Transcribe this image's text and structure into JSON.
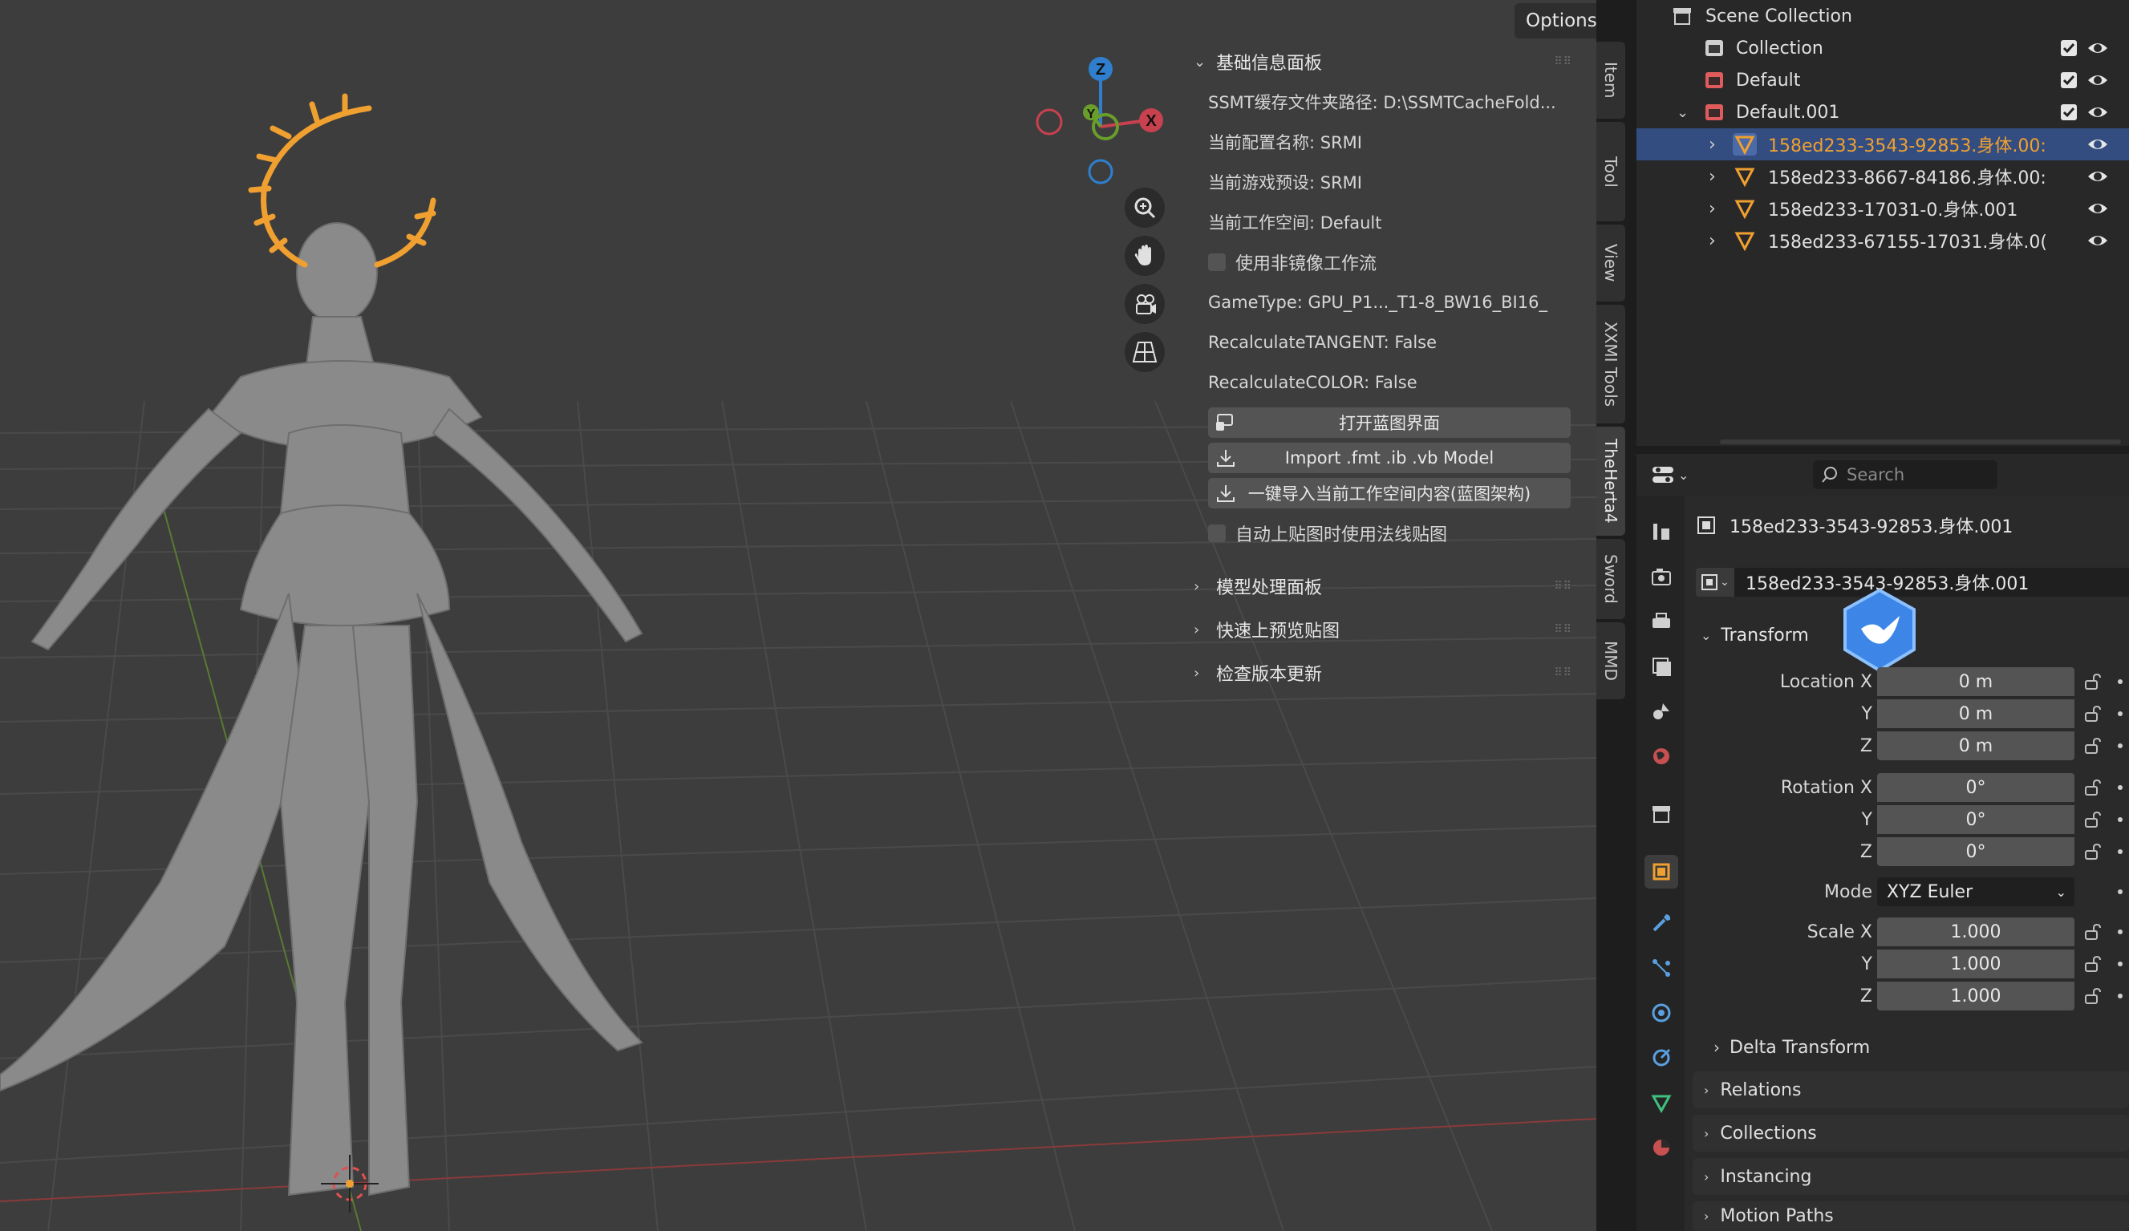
{
  "viewport": {
    "options_label": "Options",
    "gizmo": {
      "z": "Z",
      "y": "Y",
      "x": "X"
    },
    "nav_icons": [
      "zoom-icon",
      "hand-icon",
      "camera-icon",
      "grid-icon"
    ]
  },
  "npanel": {
    "basic_header": "基础信息面板",
    "lines": [
      "SSMT缓存文件夹路径: D:\\SSMTCacheFold...",
      "当前配置名称: SRMI",
      "当前游戏预设: SRMI",
      "当前工作空间: Default"
    ],
    "mirror_checkbox": "使用非镜像工作流",
    "lines2": [
      "GameType: GPU_P1..._T1-8_BW16_BI16_",
      "RecalculateTANGENT: False",
      "RecalculateCOLOR: False"
    ],
    "btn_blueprint": "打开蓝图界面",
    "btn_import": "Import .fmt .ib .vb Model",
    "btn_onekey": "一键导入当前工作空间内容(蓝图架构)",
    "normalmap_checkbox": "自动上贴图时使用法线贴图",
    "collapsed": [
      "模型处理面板",
      "快速上预览贴图",
      "检查版本更新"
    ]
  },
  "vtabs": [
    "Item",
    "Tool",
    "View",
    "XXMI Tools",
    "TheHerta4",
    "Sword",
    "MMD"
  ],
  "outliner": {
    "scene_collection": "Scene Collection",
    "rows": [
      {
        "label": "Collection"
      },
      {
        "label": "Default"
      },
      {
        "label": "Default.001"
      },
      {
        "label": "158ed233-3543-92853.身体.00:"
      },
      {
        "label": "158ed233-8667-84186.身体.00:"
      },
      {
        "label": "158ed233-17031-0.身体.001"
      },
      {
        "label": "158ed233-67155-17031.身体.0("
      }
    ]
  },
  "properties": {
    "search_placeholder": "Search",
    "object_name": "158ed233-3543-92853.身体.001",
    "object_field": "158ed233-3543-92853.身体.001",
    "transform_label": "Transform",
    "location": {
      "label_x": "Location X",
      "label_y": "Y",
      "label_z": "Z",
      "x": "0 m",
      "y": "0 m",
      "z": "0 m"
    },
    "rotation": {
      "label_x": "Rotation X",
      "label_y": "Y",
      "label_z": "Z",
      "x": "0°",
      "y": "0°",
      "z": "0°"
    },
    "mode": {
      "label": "Mode",
      "value": "XYZ Euler"
    },
    "scale": {
      "label_x": "Scale X",
      "label_y": "Y",
      "label_z": "Z",
      "x": "1.000",
      "y": "1.000",
      "z": "1.000"
    },
    "delta_transform": "Delta Transform",
    "sections": [
      "Relations",
      "Collections",
      "Instancing",
      "Motion Paths"
    ]
  },
  "colors": {
    "accent_orange": "#f0a030",
    "selection_blue": "#334d80",
    "axis_x": "#c8414e",
    "axis_y": "#6a9e2a",
    "axis_z": "#2f7fce"
  }
}
